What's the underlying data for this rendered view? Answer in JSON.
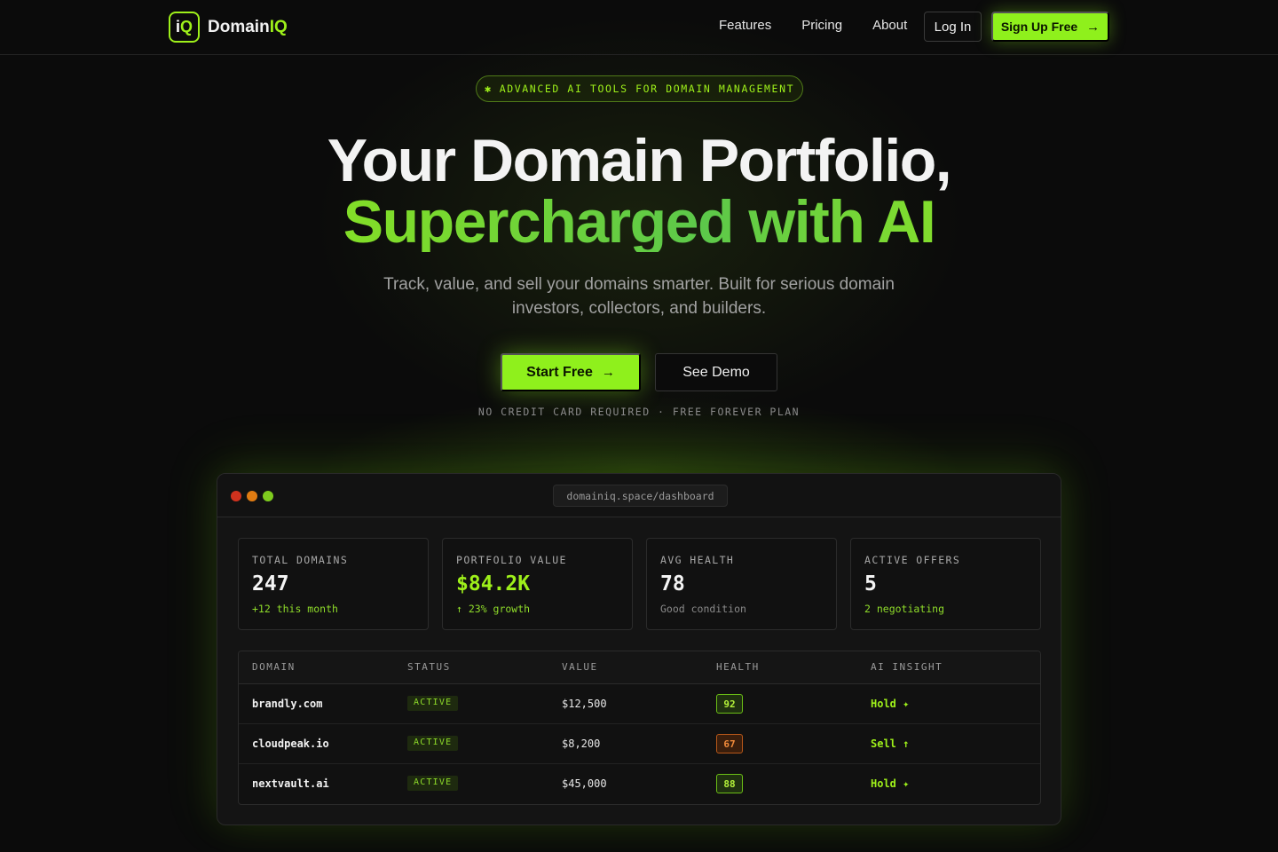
{
  "nav": {
    "logo_mark_i": "i",
    "logo_mark_q": "Q",
    "logo_word": "Domain",
    "logo_word_accent": "IQ",
    "links": [
      "Features",
      "Pricing",
      "About"
    ],
    "login_label": "Log In",
    "signup_label": "Sign Up Free",
    "arrow": "→"
  },
  "hero": {
    "badge_icon": "✱",
    "badge_text": "ADVANCED AI TOOLS FOR DOMAIN MANAGEMENT",
    "title_line1": "Your Domain Portfolio,",
    "title_line2": "Supercharged with AI",
    "subtitle": "Track, value, and sell your domains smarter. Built for serious domain investors, collectors, and builders.",
    "cta_primary": "Start Free",
    "cta_secondary": "See Demo",
    "fine_print": "NO CREDIT CARD REQUIRED · FREE FOREVER PLAN"
  },
  "dashboard": {
    "url": "domainiq.space/dashboard",
    "stats": [
      {
        "label": "TOTAL DOMAINS",
        "value": "247",
        "note": "+12 this month"
      },
      {
        "label": "PORTFOLIO VALUE",
        "value": "$84.2K",
        "note": "↑ 23% growth"
      },
      {
        "label": "AVG HEALTH",
        "value": "78",
        "note": "Good condition"
      },
      {
        "label": "ACTIVE OFFERS",
        "value": "5",
        "note": "2 negotiating"
      }
    ],
    "columns": [
      "DOMAIN",
      "STATUS",
      "VALUE",
      "HEALTH",
      "AI INSIGHT"
    ],
    "rows": [
      {
        "domain": "brandly.com",
        "status": "ACTIVE",
        "value": "$12,500",
        "health": "92",
        "insight": "Hold ✦"
      },
      {
        "domain": "cloudpeak.io",
        "status": "ACTIVE",
        "value": "$8,200",
        "health": "67",
        "insight": "Sell ↑"
      },
      {
        "domain": "nextvault.ai",
        "status": "ACTIVE",
        "value": "$45,000",
        "health": "88",
        "insight": "Hold ✦"
      }
    ]
  },
  "colors": {
    "accent": "#9ef01a",
    "background": "#0b0b0b",
    "warning": "#f08a3a"
  }
}
